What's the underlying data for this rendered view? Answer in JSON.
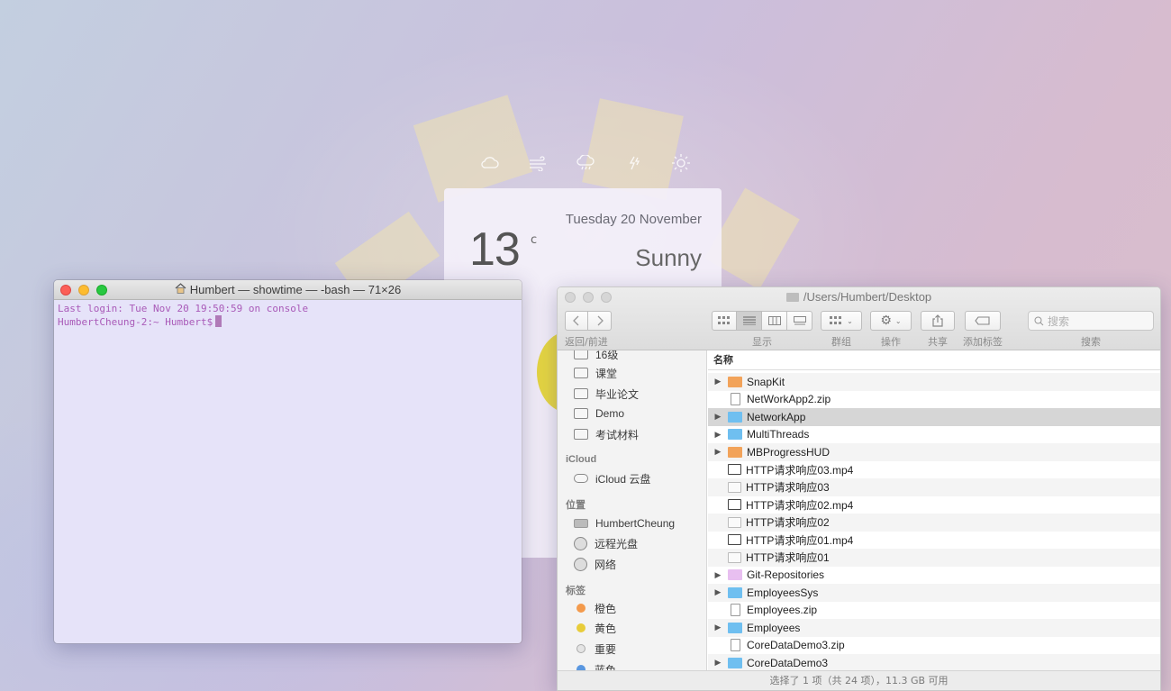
{
  "weather": {
    "icons": [
      "cloud-icon",
      "wind-icon",
      "rain-icon",
      "thunder-icon",
      "sun-icon"
    ],
    "temperature": "13",
    "unit": "c",
    "date": "Tuesday 20 November",
    "condition": "Sunny"
  },
  "terminal": {
    "title": "Humbert — showtime — -bash — 71×26",
    "line1": "Last login: Tue Nov 20 19:50:59 on console",
    "prompt": "HumbertCheung-2:~ Humbert$"
  },
  "finder": {
    "title": "/Users/Humbert/Desktop",
    "toolbar": {
      "nav_label": "返回/前进",
      "view_label": "显示",
      "group_label": "群组",
      "action_label": "操作",
      "share_label": "共享",
      "tag_label": "添加标签",
      "search_label": "搜索",
      "search_placeholder": "搜索"
    },
    "sidebar": {
      "favorites": [
        "16级",
        "课堂",
        "毕业论文",
        "Demo",
        "考试材料"
      ],
      "icloud_header": "iCloud",
      "icloud": [
        "iCloud 云盘"
      ],
      "locations_header": "位置",
      "locations": [
        "HumbertCheung",
        "远程光盘",
        "网络"
      ],
      "tags_header": "标签",
      "tags": [
        {
          "label": "橙色",
          "color": "#f39a4c"
        },
        {
          "label": "黄色",
          "color": "#e8cc3a"
        },
        {
          "label": "重要",
          "color": "#d8d8d8"
        },
        {
          "label": "蓝色",
          "color": "#5a97e0"
        }
      ]
    },
    "column_header": "名称",
    "files": [
      {
        "name": "SnapKit",
        "kind": "folder-orange",
        "expandable": true
      },
      {
        "name": "NetWorkApp2.zip",
        "kind": "zip",
        "expandable": false
      },
      {
        "name": "NetworkApp",
        "kind": "folder-blue",
        "expandable": true,
        "selected": true
      },
      {
        "name": "MultiThreads",
        "kind": "folder-blue",
        "expandable": true
      },
      {
        "name": "MBProgressHUD",
        "kind": "folder-orange",
        "expandable": true
      },
      {
        "name": "HTTP请求响应03.mp4",
        "kind": "video",
        "expandable": false
      },
      {
        "name": "HTTP请求响应03",
        "kind": "doc",
        "expandable": false
      },
      {
        "name": "HTTP请求响应02.mp4",
        "kind": "video",
        "expandable": false
      },
      {
        "name": "HTTP请求响应02",
        "kind": "doc",
        "expandable": false
      },
      {
        "name": "HTTP请求响应01.mp4",
        "kind": "video",
        "expandable": false
      },
      {
        "name": "HTTP请求响应01",
        "kind": "doc",
        "expandable": false
      },
      {
        "name": "Git-Repositories",
        "kind": "folder-pink",
        "expandable": true
      },
      {
        "name": "EmployeesSys",
        "kind": "folder-blue",
        "expandable": true
      },
      {
        "name": "Employees.zip",
        "kind": "zip",
        "expandable": false
      },
      {
        "name": "Employees",
        "kind": "folder-blue",
        "expandable": true
      },
      {
        "name": "CoreDataDemo3.zip",
        "kind": "zip",
        "expandable": false
      },
      {
        "name": "CoreDataDemo3",
        "kind": "folder-blue",
        "expandable": true
      }
    ],
    "status": "选择了 1 项（共 24 项），11.3 GB 可用"
  }
}
